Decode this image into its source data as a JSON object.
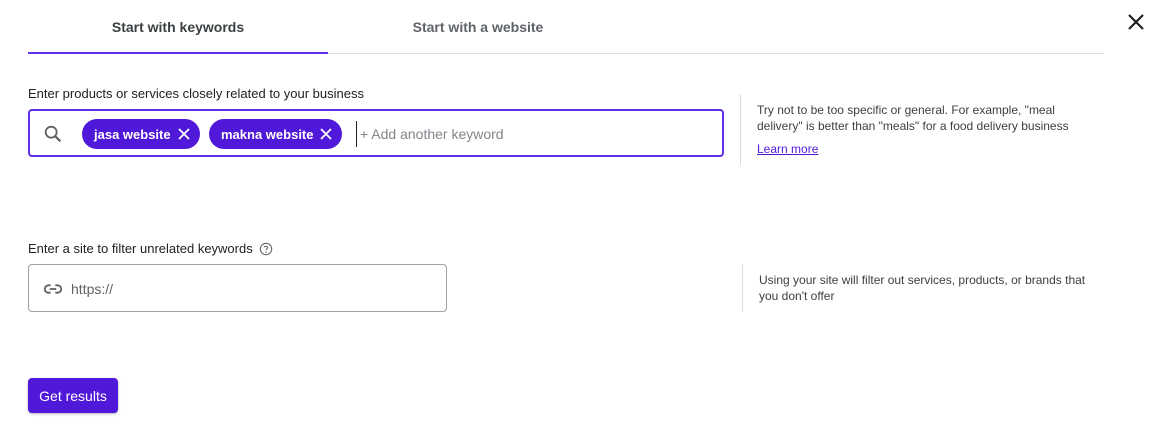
{
  "tabs": [
    {
      "label": "Start with keywords",
      "active": true
    },
    {
      "label": "Start with a website",
      "active": false
    }
  ],
  "keywords": {
    "label": "Enter products or services closely related to your business",
    "chips": [
      "jasa website",
      "makna website"
    ],
    "placeholder": "+ Add another keyword",
    "hint": "Try not to be too specific or general. For example, \"meal delivery\" is better than \"meals\" for a food delivery business",
    "learn_more": "Learn more"
  },
  "site": {
    "label": "Enter a site to filter unrelated keywords",
    "placeholder": "https://",
    "hint": "Using your site will filter out services, products, or brands that you don't offer"
  },
  "action": {
    "label": "Get results"
  },
  "icons": {
    "close": "close-icon",
    "search": "search-icon",
    "chip_remove": "close-icon",
    "help": "help-outline-icon",
    "link": "link-icon"
  },
  "colors": {
    "accent": "#5f2eea",
    "chip": "#5018d8"
  }
}
